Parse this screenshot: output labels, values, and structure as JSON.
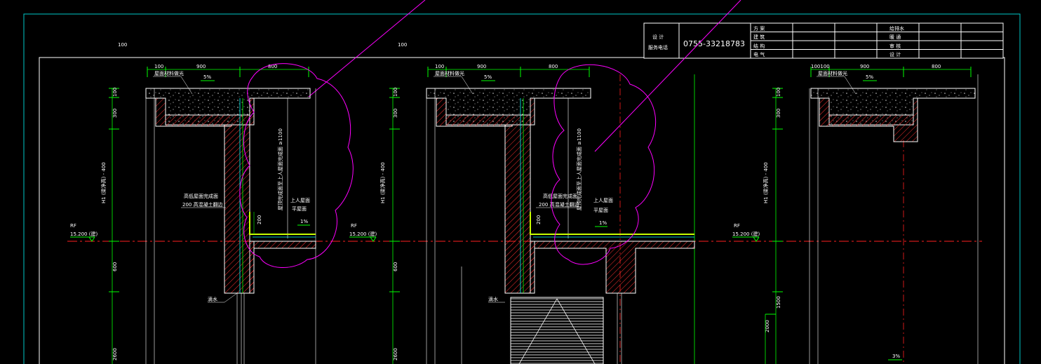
{
  "title_block": {
    "phone_label_line1": "设 计",
    "phone_label_line2": "服务电话",
    "phone_number": "0755-33218783",
    "roles_left": [
      "方 案",
      "建 筑",
      "结 构",
      "电 气"
    ],
    "roles_right": [
      "给排水",
      "暖 通",
      "审 核",
      "设 计"
    ]
  },
  "top_dims": [
    "100",
    "100"
  ],
  "sections": [
    {
      "dims_top": [
        "100",
        "900",
        "800"
      ],
      "roof_note": "屋面材料做光",
      "slope": "5%",
      "vert_dims": [
        "100",
        "300",
        "H1 (梁净高) - 400",
        "600",
        "2600"
      ],
      "level_mark": "RF",
      "level_value": "15.200 (建)",
      "parapet_note_1": "高低屋面完成面",
      "parapet_note_2": "200 高混凝土翻边",
      "door_note": "屋顶完成面至上人屋面完成面 ≥1100",
      "parapet_height": "200",
      "deck_label_1": "上人屋面",
      "deck_label_2": "平屋面",
      "deck_slope": "1%",
      "drip_note": "滴水"
    },
    {
      "dims_top": [
        "100",
        "900",
        "800"
      ],
      "roof_note": "屋面材料做光",
      "slope": "5%",
      "vert_dims": [
        "100",
        "300",
        "H1 (梁净高) - 400",
        "600",
        "2600"
      ],
      "level_mark": "RF",
      "level_value": "15.200 (建)",
      "parapet_note_1": "高低屋面完成面",
      "parapet_note_2": "200 高混凝土翻边",
      "door_note": "屋顶完成面至上人屋面完成面 ≥1100",
      "parapet_height": "200",
      "deck_label_1": "上人屋面",
      "deck_label_2": "平屋面",
      "deck_slope": "1%",
      "drip_note": "滴水"
    },
    {
      "dims_top": [
        "100100",
        "900",
        "800"
      ],
      "roof_note": "屋面材料做光",
      "slope": "5%",
      "vert_dims": [
        "100",
        "300",
        "H1 (梁净高) - 400",
        "1500",
        "2000"
      ],
      "level_mark": "RF",
      "level_value": "15.200 (建)",
      "deck_slope": "3%",
      "bottom_slope": "3%"
    }
  ],
  "colors": {
    "frame": "#00c8c8",
    "hatch": "#ff3030",
    "green": "#00ff00",
    "magenta": "#ff00ff",
    "white": "#ffffff",
    "red_axis": "#ff2020",
    "yellow_green": "#c8ff00"
  }
}
